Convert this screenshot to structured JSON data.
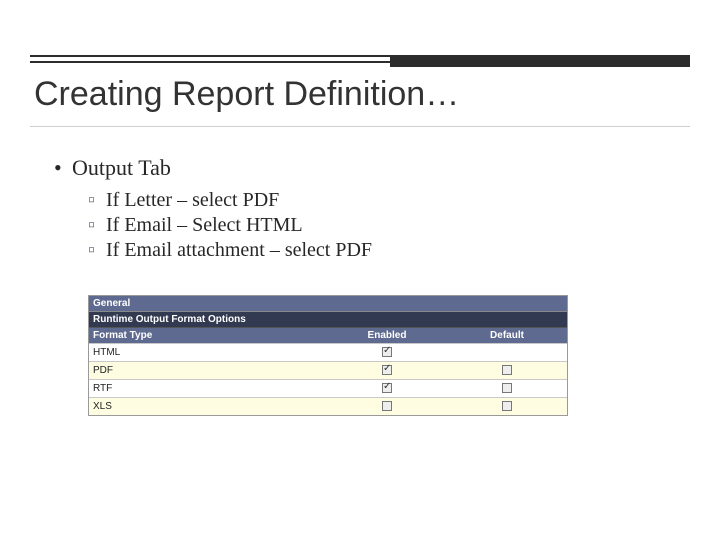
{
  "title": "Creating Report Definition…",
  "bullet_main": "Output Tab",
  "sub_bullets": [
    "If Letter – select PDF",
    "If Email – Select HTML",
    "If Email attachment – select PDF"
  ],
  "table": {
    "general_label": "General",
    "runtime_label": "Runtime Output Format Options",
    "col_format": "Format Type",
    "col_enabled": "Enabled",
    "col_default": "Default",
    "rows": [
      {
        "format": "HTML",
        "enabled": true,
        "default": false,
        "default_shown": false
      },
      {
        "format": "PDF",
        "enabled": true,
        "default": false,
        "default_shown": true
      },
      {
        "format": "RTF",
        "enabled": true,
        "default": false,
        "default_shown": true
      },
      {
        "format": "XLS",
        "enabled": false,
        "default": false,
        "default_shown": true
      }
    ]
  }
}
